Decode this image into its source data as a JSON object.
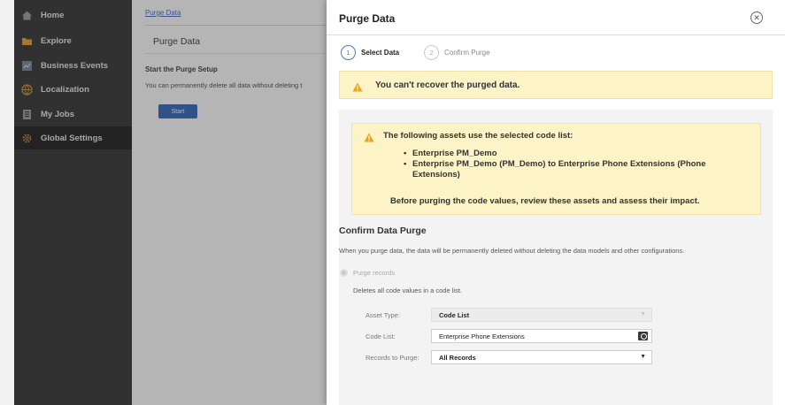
{
  "sidebar": {
    "items": [
      {
        "label": "Home",
        "icon": "home-icon",
        "color": "#9a9a9a"
      },
      {
        "label": "Explore",
        "icon": "folder-icon",
        "color": "#e0a020"
      },
      {
        "label": "Business Events",
        "icon": "events-icon",
        "color": "#8a9bb0"
      },
      {
        "label": "Localization",
        "icon": "globe-icon",
        "color": "#d08a20"
      },
      {
        "label": "My Jobs",
        "icon": "jobs-icon",
        "color": "#9a9a9a"
      },
      {
        "label": "Global Settings",
        "icon": "gear-icon",
        "color": "#d08a20"
      }
    ]
  },
  "background_page": {
    "breadcrumb": "Purge Data",
    "title": "Purge Data",
    "subtitle": "Start the Purge Setup",
    "description": "You can permanently delete all data without deleting t",
    "start_button": "Start"
  },
  "dialog": {
    "title": "Purge Data",
    "steps": [
      {
        "number": "1",
        "label": "Select Data"
      },
      {
        "number": "2",
        "label": "Confirm Purge"
      }
    ],
    "warning_banner": "You can't recover the purged data.",
    "assets_warning": {
      "heading": "The following assets use the selected code list:",
      "items": [
        "Enterprise PM_Demo",
        "Enterprise PM_Demo (PM_Demo) to Enterprise Phone Extensions (Phone Extensions)"
      ],
      "footer": "Before purging the code values, review these assets and assess their impact."
    },
    "confirm_section": {
      "title": "Confirm Data Purge",
      "description": "When you purge data, the data will be permanently deleted without deleting the data models and other configurations.",
      "radio_label": "Purge records",
      "radio_description": "Deletes all code values in a code list."
    },
    "fields": {
      "asset_type_label": "Asset Type:",
      "asset_type_value": "Code List",
      "code_list_label": "Code List:",
      "code_list_value": "Enterprise Phone Extensions",
      "records_label": "Records to Purge:",
      "records_value": "All Records"
    }
  },
  "colors": {
    "warning_bg": "#fcf3c6",
    "accent": "#3a7bd5",
    "sidebar_bg": "#2b2b2b"
  }
}
